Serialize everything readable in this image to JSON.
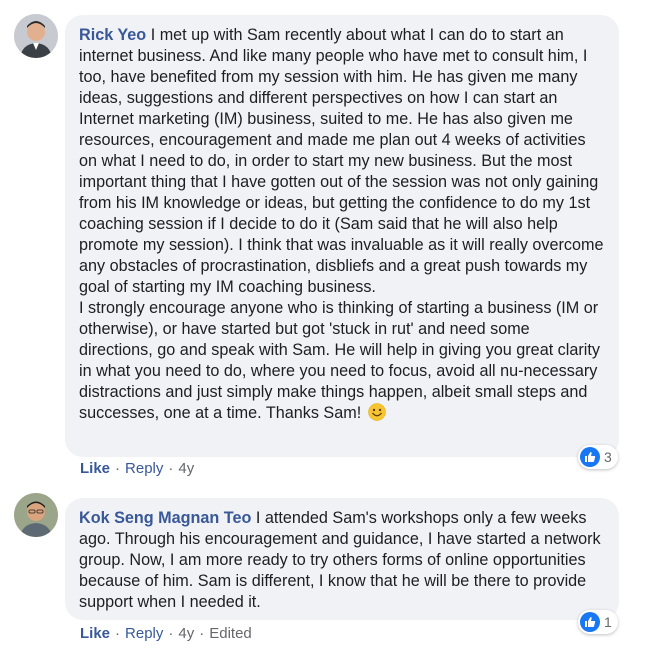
{
  "comments": [
    {
      "author": "Rick Yeo",
      "text": " I met up with Sam recently about what I can do to start an internet business. And like many people who have met to consult him, I too, have benefited from my session with him. He has given me many ideas, suggestions and different perspectives on how I can start an Internet marketing (IM) business, suited to me. He has also given me resources, encouragement and made me plan out 4 weeks of activities on what I need to do, in order to start my new business. But the most important thing that I have gotten out of the session was not only gaining from his IM knowledge or ideas, but getting the confidence to do my 1st coaching session if I decide to do it (Sam said that he will also help promote my session). I think that was invaluable as it will really overcome any obstacles of procrastination, disbliefs and a great push towards my goal of starting my IM coaching business.\nI strongly encourage anyone who is thinking of starting a business (IM or otherwise), or have started but got 'stuck in rut' and need some directions, go and speak with Sam. He will help in giving you great clarity in what you need to do, where you need to focus, avoid all nu-necessary distractions and just simply make things happen, albeit small steps and successes, one at a time. Thanks Sam! ",
      "emoji": "smile-emoji",
      "reaction_count": "3",
      "like_label": "Like",
      "reply_label": "Reply",
      "age": "4y",
      "edited_label": ""
    },
    {
      "author": "Kok Seng Magnan Teo",
      "text": " I attended Sam's workshops only a few weeks ago. Through his encouragement and guidance, I have started a network group. Now, I am more ready to try others forms of online opportunities because of him. Sam is different, I know that he will be there to provide support when I needed it.",
      "emoji": "",
      "reaction_count": "1",
      "like_label": "Like",
      "reply_label": "Reply",
      "age": "4y",
      "edited_label": "Edited"
    }
  ],
  "separator": "·",
  "colors": {
    "author": "#385898",
    "bubble": "#f0f2f5",
    "meta": "#65676b",
    "like_badge": "#1877f2"
  }
}
